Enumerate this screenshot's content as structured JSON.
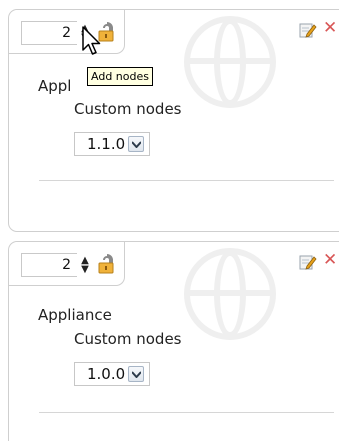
{
  "cards": [
    {
      "node_count": "2",
      "title": "Appl",
      "subtitle": "Custom nodes",
      "version": "1.1.0"
    },
    {
      "node_count": "2",
      "title": "Appliance",
      "subtitle": "Custom nodes",
      "version": "1.0.0"
    }
  ],
  "tooltip": {
    "text": "Add nodes"
  },
  "icons": {
    "stepper": "up-down-arrows-icon",
    "lock": "padlock-icon",
    "edit": "pencil-edit-icon",
    "remove": "red-x-icon",
    "dropdown": "chevron-down-icon",
    "cursor": "mouse-pointer-icon",
    "watermark": "globe-icon"
  },
  "colors": {
    "remove_icon": "#d85656",
    "lock_icon": "#e8a21a",
    "tooltip_bg": "#ffffe1"
  }
}
